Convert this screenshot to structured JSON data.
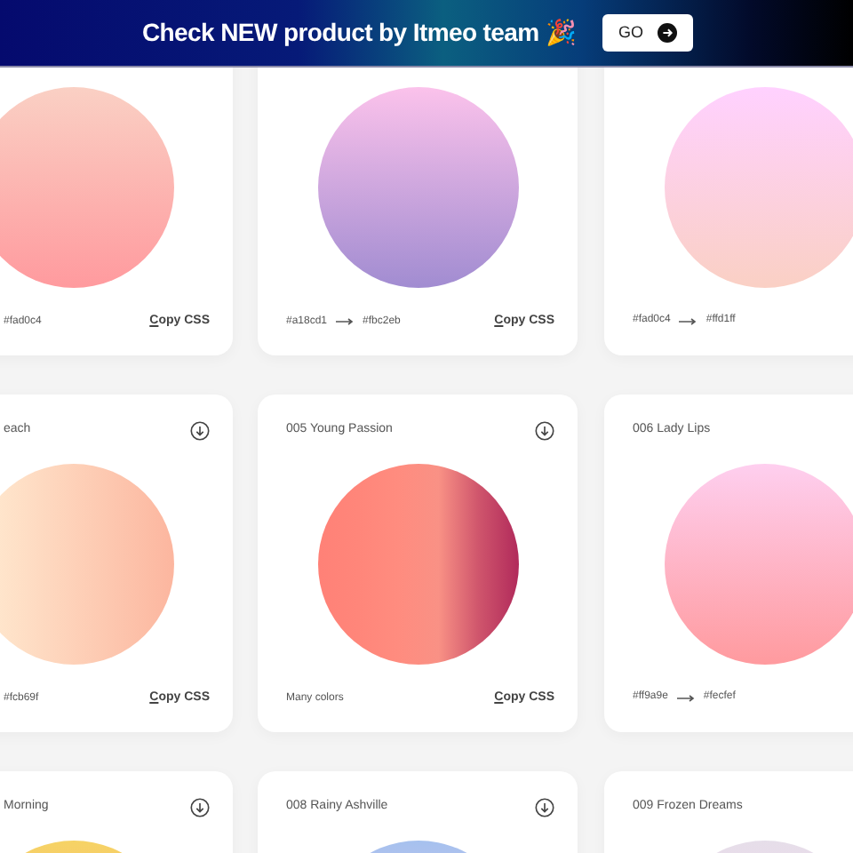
{
  "banner": {
    "text": "Check NEW product by Itmeo team 🎉",
    "button": "GO"
  },
  "rows": [
    [
      {
        "footer": {
          "kind": "stops",
          "stops": [
            "#fad0c4"
          ]
        },
        "copy_label": "Copy CSS"
      },
      {
        "footer": {
          "kind": "stops",
          "stops": [
            "#a18cd1",
            "#fbc2eb"
          ]
        },
        "copy_label": "Copy CSS"
      },
      {
        "footer": {
          "kind": "stops",
          "stops": [
            "#fad0c4",
            "#ffd1ff"
          ]
        }
      }
    ],
    [
      {
        "title": "each",
        "download_icon": true,
        "footer": {
          "kind": "stops",
          "stops": [
            "#fcb69f"
          ]
        },
        "copy_label": "Copy CSS"
      },
      {
        "title": "005 Young Passion",
        "download_icon": true,
        "footer": {
          "kind": "text",
          "text": "Many colors"
        },
        "copy_label": "Copy CSS"
      },
      {
        "title": "006 Lady Lips",
        "download_icon": false,
        "footer": {
          "kind": "stops",
          "stops": [
            "#ff9a9e",
            "#fecfef"
          ]
        }
      }
    ],
    [
      {
        "title": "Morning",
        "download_icon": true
      },
      {
        "title": "008 Rainy Ashville",
        "download_icon": true
      },
      {
        "title": "009 Frozen Dreams",
        "download_icon": false
      }
    ]
  ]
}
